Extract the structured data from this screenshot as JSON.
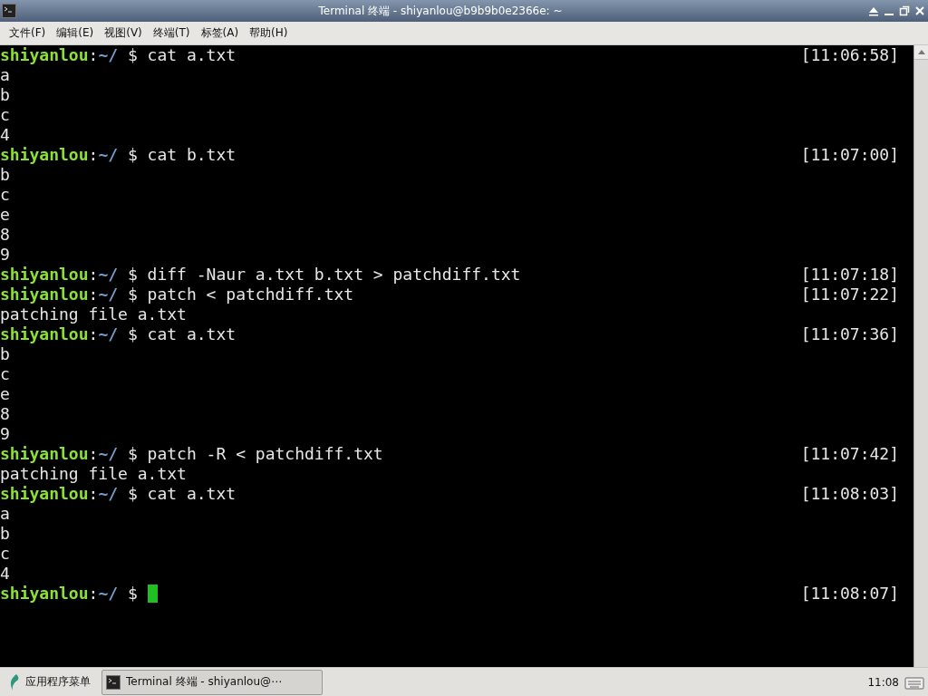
{
  "window": {
    "title": "Terminal 终端 - shiyanlou@b9b9b0e2366e: ~"
  },
  "menu": [
    "文件(F)",
    "编辑(E)",
    "视图(V)",
    "终端(T)",
    "标签(A)",
    "帮助(H)"
  ],
  "terminal": {
    "lines": [
      {
        "kind": "prompt",
        "user": "shiyanlou",
        "sep": ":",
        "path": "~/",
        "sign": "$",
        "command": "cat a.txt",
        "time": "[11:06:58]"
      },
      {
        "kind": "output",
        "text": "a"
      },
      {
        "kind": "output",
        "text": "b"
      },
      {
        "kind": "output",
        "text": "c"
      },
      {
        "kind": "output",
        "text": "4"
      },
      {
        "kind": "prompt",
        "user": "shiyanlou",
        "sep": ":",
        "path": "~/",
        "sign": "$",
        "command": "cat b.txt",
        "time": "[11:07:00]"
      },
      {
        "kind": "output",
        "text": "b"
      },
      {
        "kind": "output",
        "text": "c"
      },
      {
        "kind": "output",
        "text": "e"
      },
      {
        "kind": "output",
        "text": "8"
      },
      {
        "kind": "output",
        "text": "9"
      },
      {
        "kind": "prompt",
        "user": "shiyanlou",
        "sep": ":",
        "path": "~/",
        "sign": "$",
        "command": "diff -Naur a.txt b.txt > patchdiff.txt",
        "time": "[11:07:18]"
      },
      {
        "kind": "prompt",
        "user": "shiyanlou",
        "sep": ":",
        "path": "~/",
        "sign": "$",
        "command": "patch < patchdiff.txt",
        "time": "[11:07:22]"
      },
      {
        "kind": "output",
        "text": "patching file a.txt"
      },
      {
        "kind": "prompt",
        "user": "shiyanlou",
        "sep": ":",
        "path": "~/",
        "sign": "$",
        "command": "cat a.txt",
        "time": "[11:07:36]"
      },
      {
        "kind": "output",
        "text": "b"
      },
      {
        "kind": "output",
        "text": "c"
      },
      {
        "kind": "output",
        "text": "e"
      },
      {
        "kind": "output",
        "text": "8"
      },
      {
        "kind": "output",
        "text": "9"
      },
      {
        "kind": "prompt",
        "user": "shiyanlou",
        "sep": ":",
        "path": "~/",
        "sign": "$",
        "command": "patch -R < patchdiff.txt",
        "time": "[11:07:42]"
      },
      {
        "kind": "output",
        "text": "patching file a.txt"
      },
      {
        "kind": "prompt",
        "user": "shiyanlou",
        "sep": ":",
        "path": "~/",
        "sign": "$",
        "command": "cat a.txt",
        "time": "[11:08:03]"
      },
      {
        "kind": "output",
        "text": "a"
      },
      {
        "kind": "output",
        "text": "b"
      },
      {
        "kind": "output",
        "text": "c"
      },
      {
        "kind": "output",
        "text": "4"
      },
      {
        "kind": "prompt",
        "user": "shiyanlou",
        "sep": ":",
        "path": "~/",
        "sign": "$",
        "cursor": true,
        "time": "[11:08:07]"
      }
    ]
  },
  "taskbar": {
    "app_menu": "应用程序菜单",
    "task": "Terminal 终端 - shiyanlou@⋯",
    "clock": "11:08"
  }
}
